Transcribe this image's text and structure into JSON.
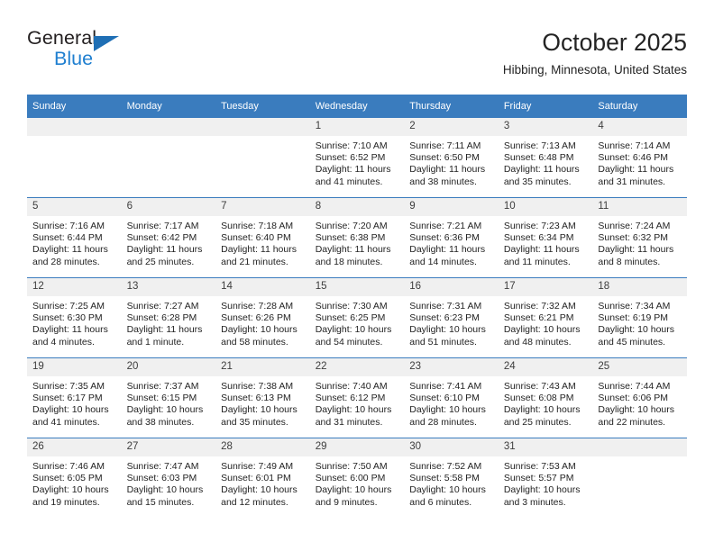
{
  "brand": {
    "name_top": "General",
    "name_bottom": "Blue",
    "accent_dark": "#231f20",
    "accent_blue": "#1f7fd0",
    "triangle_color": "#1f6fb5"
  },
  "header": {
    "title": "October 2025",
    "subtitle": "Hibbing, Minnesota, United States"
  },
  "theme": {
    "header_blue": "#3a7cbe",
    "daynum_band": "#f0f0f0",
    "text": "#232323"
  },
  "weekdays": [
    "Sunday",
    "Monday",
    "Tuesday",
    "Wednesday",
    "Thursday",
    "Friday",
    "Saturday"
  ],
  "labels": {
    "sunrise": "Sunrise:",
    "sunset": "Sunset:",
    "daylight": "Daylight:"
  },
  "weeks": [
    [
      {
        "day": "",
        "sunrise": "",
        "sunset": "",
        "daylight_l1": "",
        "daylight_l2": ""
      },
      {
        "day": "",
        "sunrise": "",
        "sunset": "",
        "daylight_l1": "",
        "daylight_l2": ""
      },
      {
        "day": "",
        "sunrise": "",
        "sunset": "",
        "daylight_l1": "",
        "daylight_l2": ""
      },
      {
        "day": "1",
        "sunrise": "Sunrise: 7:10 AM",
        "sunset": "Sunset: 6:52 PM",
        "daylight_l1": "Daylight: 11 hours",
        "daylight_l2": "and 41 minutes."
      },
      {
        "day": "2",
        "sunrise": "Sunrise: 7:11 AM",
        "sunset": "Sunset: 6:50 PM",
        "daylight_l1": "Daylight: 11 hours",
        "daylight_l2": "and 38 minutes."
      },
      {
        "day": "3",
        "sunrise": "Sunrise: 7:13 AM",
        "sunset": "Sunset: 6:48 PM",
        "daylight_l1": "Daylight: 11 hours",
        "daylight_l2": "and 35 minutes."
      },
      {
        "day": "4",
        "sunrise": "Sunrise: 7:14 AM",
        "sunset": "Sunset: 6:46 PM",
        "daylight_l1": "Daylight: 11 hours",
        "daylight_l2": "and 31 minutes."
      }
    ],
    [
      {
        "day": "5",
        "sunrise": "Sunrise: 7:16 AM",
        "sunset": "Sunset: 6:44 PM",
        "daylight_l1": "Daylight: 11 hours",
        "daylight_l2": "and 28 minutes."
      },
      {
        "day": "6",
        "sunrise": "Sunrise: 7:17 AM",
        "sunset": "Sunset: 6:42 PM",
        "daylight_l1": "Daylight: 11 hours",
        "daylight_l2": "and 25 minutes."
      },
      {
        "day": "7",
        "sunrise": "Sunrise: 7:18 AM",
        "sunset": "Sunset: 6:40 PM",
        "daylight_l1": "Daylight: 11 hours",
        "daylight_l2": "and 21 minutes."
      },
      {
        "day": "8",
        "sunrise": "Sunrise: 7:20 AM",
        "sunset": "Sunset: 6:38 PM",
        "daylight_l1": "Daylight: 11 hours",
        "daylight_l2": "and 18 minutes."
      },
      {
        "day": "9",
        "sunrise": "Sunrise: 7:21 AM",
        "sunset": "Sunset: 6:36 PM",
        "daylight_l1": "Daylight: 11 hours",
        "daylight_l2": "and 14 minutes."
      },
      {
        "day": "10",
        "sunrise": "Sunrise: 7:23 AM",
        "sunset": "Sunset: 6:34 PM",
        "daylight_l1": "Daylight: 11 hours",
        "daylight_l2": "and 11 minutes."
      },
      {
        "day": "11",
        "sunrise": "Sunrise: 7:24 AM",
        "sunset": "Sunset: 6:32 PM",
        "daylight_l1": "Daylight: 11 hours",
        "daylight_l2": "and 8 minutes."
      }
    ],
    [
      {
        "day": "12",
        "sunrise": "Sunrise: 7:25 AM",
        "sunset": "Sunset: 6:30 PM",
        "daylight_l1": "Daylight: 11 hours",
        "daylight_l2": "and 4 minutes."
      },
      {
        "day": "13",
        "sunrise": "Sunrise: 7:27 AM",
        "sunset": "Sunset: 6:28 PM",
        "daylight_l1": "Daylight: 11 hours",
        "daylight_l2": "and 1 minute."
      },
      {
        "day": "14",
        "sunrise": "Sunrise: 7:28 AM",
        "sunset": "Sunset: 6:26 PM",
        "daylight_l1": "Daylight: 10 hours",
        "daylight_l2": "and 58 minutes."
      },
      {
        "day": "15",
        "sunrise": "Sunrise: 7:30 AM",
        "sunset": "Sunset: 6:25 PM",
        "daylight_l1": "Daylight: 10 hours",
        "daylight_l2": "and 54 minutes."
      },
      {
        "day": "16",
        "sunrise": "Sunrise: 7:31 AM",
        "sunset": "Sunset: 6:23 PM",
        "daylight_l1": "Daylight: 10 hours",
        "daylight_l2": "and 51 minutes."
      },
      {
        "day": "17",
        "sunrise": "Sunrise: 7:32 AM",
        "sunset": "Sunset: 6:21 PM",
        "daylight_l1": "Daylight: 10 hours",
        "daylight_l2": "and 48 minutes."
      },
      {
        "day": "18",
        "sunrise": "Sunrise: 7:34 AM",
        "sunset": "Sunset: 6:19 PM",
        "daylight_l1": "Daylight: 10 hours",
        "daylight_l2": "and 45 minutes."
      }
    ],
    [
      {
        "day": "19",
        "sunrise": "Sunrise: 7:35 AM",
        "sunset": "Sunset: 6:17 PM",
        "daylight_l1": "Daylight: 10 hours",
        "daylight_l2": "and 41 minutes."
      },
      {
        "day": "20",
        "sunrise": "Sunrise: 7:37 AM",
        "sunset": "Sunset: 6:15 PM",
        "daylight_l1": "Daylight: 10 hours",
        "daylight_l2": "and 38 minutes."
      },
      {
        "day": "21",
        "sunrise": "Sunrise: 7:38 AM",
        "sunset": "Sunset: 6:13 PM",
        "daylight_l1": "Daylight: 10 hours",
        "daylight_l2": "and 35 minutes."
      },
      {
        "day": "22",
        "sunrise": "Sunrise: 7:40 AM",
        "sunset": "Sunset: 6:12 PM",
        "daylight_l1": "Daylight: 10 hours",
        "daylight_l2": "and 31 minutes."
      },
      {
        "day": "23",
        "sunrise": "Sunrise: 7:41 AM",
        "sunset": "Sunset: 6:10 PM",
        "daylight_l1": "Daylight: 10 hours",
        "daylight_l2": "and 28 minutes."
      },
      {
        "day": "24",
        "sunrise": "Sunrise: 7:43 AM",
        "sunset": "Sunset: 6:08 PM",
        "daylight_l1": "Daylight: 10 hours",
        "daylight_l2": "and 25 minutes."
      },
      {
        "day": "25",
        "sunrise": "Sunrise: 7:44 AM",
        "sunset": "Sunset: 6:06 PM",
        "daylight_l1": "Daylight: 10 hours",
        "daylight_l2": "and 22 minutes."
      }
    ],
    [
      {
        "day": "26",
        "sunrise": "Sunrise: 7:46 AM",
        "sunset": "Sunset: 6:05 PM",
        "daylight_l1": "Daylight: 10 hours",
        "daylight_l2": "and 19 minutes."
      },
      {
        "day": "27",
        "sunrise": "Sunrise: 7:47 AM",
        "sunset": "Sunset: 6:03 PM",
        "daylight_l1": "Daylight: 10 hours",
        "daylight_l2": "and 15 minutes."
      },
      {
        "day": "28",
        "sunrise": "Sunrise: 7:49 AM",
        "sunset": "Sunset: 6:01 PM",
        "daylight_l1": "Daylight: 10 hours",
        "daylight_l2": "and 12 minutes."
      },
      {
        "day": "29",
        "sunrise": "Sunrise: 7:50 AM",
        "sunset": "Sunset: 6:00 PM",
        "daylight_l1": "Daylight: 10 hours",
        "daylight_l2": "and 9 minutes."
      },
      {
        "day": "30",
        "sunrise": "Sunrise: 7:52 AM",
        "sunset": "Sunset: 5:58 PM",
        "daylight_l1": "Daylight: 10 hours",
        "daylight_l2": "and 6 minutes."
      },
      {
        "day": "31",
        "sunrise": "Sunrise: 7:53 AM",
        "sunset": "Sunset: 5:57 PM",
        "daylight_l1": "Daylight: 10 hours",
        "daylight_l2": "and 3 minutes."
      },
      {
        "day": "",
        "sunrise": "",
        "sunset": "",
        "daylight_l1": "",
        "daylight_l2": ""
      }
    ]
  ]
}
